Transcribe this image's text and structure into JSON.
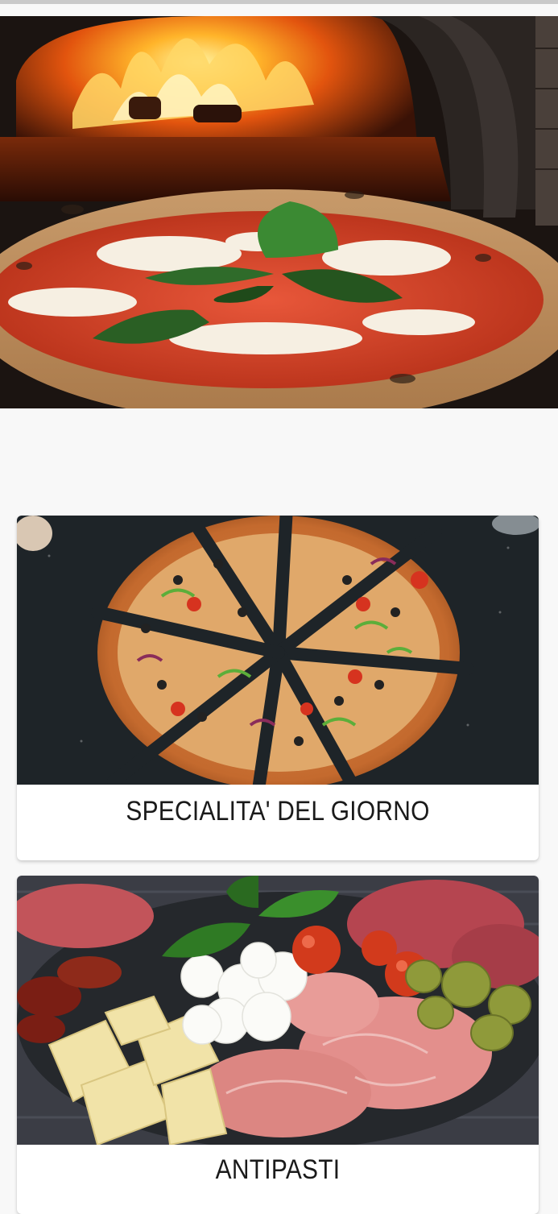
{
  "hero": {
    "image": "pizza-oven-margherita-photo"
  },
  "categories": [
    {
      "title": "SPECIALITA' DEL GIORNO",
      "image": "sliced-pizza-photo"
    },
    {
      "title": "ANTIPASTI",
      "image": "antipasto-platter-photo"
    }
  ],
  "colors": {
    "background": "#f8f8f8",
    "card": "#ffffff",
    "title_text": "#1a1a1a"
  }
}
